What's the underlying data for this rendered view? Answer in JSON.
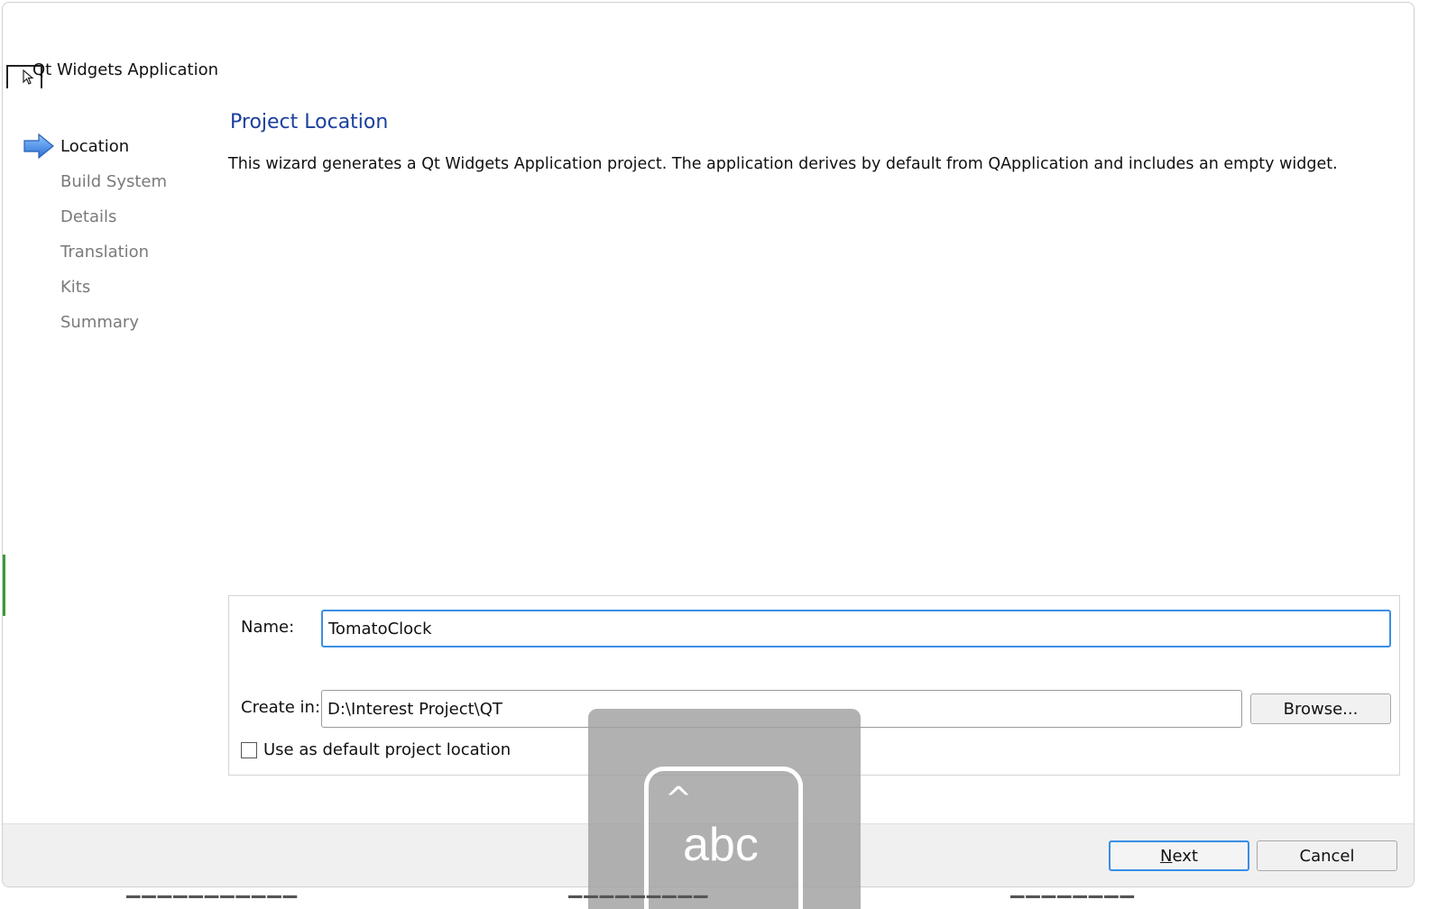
{
  "window": {
    "title": "Qt Widgets Application"
  },
  "steps": [
    {
      "label": "Location",
      "active": true
    },
    {
      "label": "Build System",
      "active": false
    },
    {
      "label": "Details",
      "active": false
    },
    {
      "label": "Translation",
      "active": false
    },
    {
      "label": "Kits",
      "active": false
    },
    {
      "label": "Summary",
      "active": false
    }
  ],
  "page": {
    "title": "Project Location",
    "description": "This wizard generates a Qt Widgets Application project. The application derives by default from QApplication and includes an empty widget."
  },
  "form": {
    "name_label": "Name:",
    "name_value": "TomatoClock",
    "create_in_label": "Create in:",
    "create_in_value": "D:\\Interest Project\\QT",
    "browse_label": "Browse...",
    "default_location_label": "Use as default project location",
    "default_location_checked": false
  },
  "buttons": {
    "next_mnemonic": "N",
    "next_rest": "ext",
    "cancel_label": "Cancel"
  },
  "ime": {
    "caret": "^",
    "mode_text": "abc"
  },
  "colors": {
    "accent": "#3a8ee6",
    "heading": "#1b3f9e",
    "inactive_step": "#7a7a7a",
    "bottom_bar": "#f0f0f0"
  }
}
